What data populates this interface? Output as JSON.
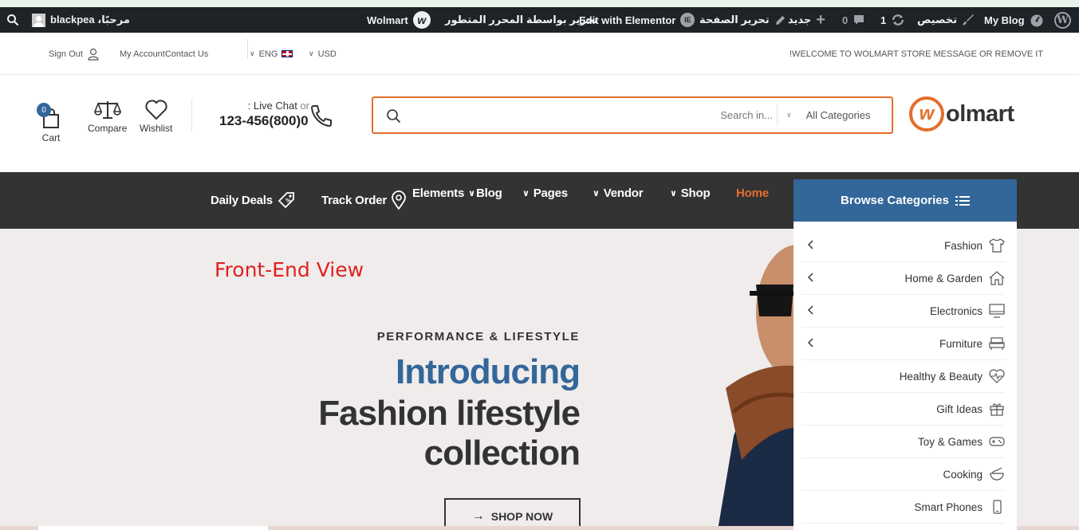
{
  "admin_bar": {
    "search_icon": "search-icon",
    "greeting": "مرحبًا، blackpea",
    "wolmart_label": "Wolmart",
    "edit_advanced": "تحرير بواسطة المحرر المتطور",
    "edit_elementor": "Edit with Elementor",
    "edit_page": "تحرير الصفحة",
    "new_label": "جديد",
    "comments_count": "0",
    "updates_count": "1",
    "customize": "تخصيص",
    "site_name": "My Blog"
  },
  "topbar": {
    "sign_out": "Sign Out",
    "my_account": "My Account",
    "contact_us": "Contact Us",
    "language": "ENG",
    "currency": "USD",
    "welcome": "!WELCOME TO WOLMART STORE MESSAGE OR REMOVE IT"
  },
  "header": {
    "cart_count": "0",
    "cart_label": "Cart",
    "compare_label": "Compare",
    "wishlist_label": "Wishlist",
    "live_chat": "Live Chat",
    "or_text": "or",
    "live_chat_suffix": ":",
    "phone": "0(800)123-456",
    "search_placeholder": "Search in...",
    "category_select": "All Categories",
    "logo_text": "olmart",
    "logo_letter": "w"
  },
  "nav": {
    "daily_deals": "Daily Deals",
    "track_order": "Track Order",
    "elements": "Elements",
    "blog": "Blog",
    "pages": "Pages",
    "vendor": "Vendor",
    "shop": "Shop",
    "home": "Home",
    "browse_categories": "Browse Categories"
  },
  "categories": [
    {
      "label": "Fashion",
      "icon": "tshirt-icon",
      "has_submenu": true
    },
    {
      "label": "Home & Garden",
      "icon": "house-icon",
      "has_submenu": true
    },
    {
      "label": "Electronics",
      "icon": "monitor-icon",
      "has_submenu": true
    },
    {
      "label": "Furniture",
      "icon": "sofa-icon",
      "has_submenu": true
    },
    {
      "label": "Healthy & Beauty",
      "icon": "heart-pulse-icon",
      "has_submenu": false
    },
    {
      "label": "Gift Ideas",
      "icon": "gift-icon",
      "has_submenu": false
    },
    {
      "label": "Toy & Games",
      "icon": "gamepad-icon",
      "has_submenu": false
    },
    {
      "label": "Cooking",
      "icon": "cooking-pot-icon",
      "has_submenu": false
    },
    {
      "label": "Smart Phones",
      "icon": "phone-icon",
      "has_submenu": false
    }
  ],
  "hero": {
    "annotation": "Front-End View",
    "subtitle": "PERFORMANCE & LIFESTYLE",
    "line1": "Introducing",
    "line2": "Fashion lifestyle",
    "line3": "collection",
    "cta": "SHOP NOW"
  },
  "colors": {
    "accent_orange": "#e36e2c",
    "brand_blue": "#336699",
    "nav_dark": "#333333",
    "admin_bar": "#1d2327"
  }
}
